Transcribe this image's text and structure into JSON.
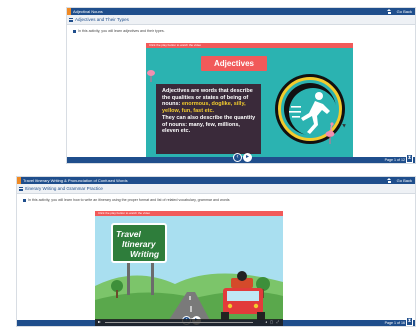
{
  "windows": [
    {
      "topbar": {
        "title": "Adjectival Nouns",
        "right_label": "Go Back"
      },
      "subbar": {
        "title": "Adjectives and Their Types"
      },
      "instruction": "In this activity, you will learn adjectives and their types.",
      "slide": {
        "header": "Click the play button to watch the video",
        "banner": "Adjectives",
        "paragraph1_pre": "Adjectives are words that describe the qualities or states of being of nouns: ",
        "paragraph1_examples": "enormous, doglike, silly, yellow, fun, fast etc.",
        "paragraph2": "They can also describe the quantity of nouns: many, few, millions, eleven etc."
      },
      "footer": {
        "page_indicator": "Page 1 of 12"
      }
    },
    {
      "topbar": {
        "title": "Travel Itinerary Writing & Pronunciation of Confused Words",
        "right_label": "Go Back"
      },
      "subbar": {
        "title": "Itinerary Writing and Grammar Practice"
      },
      "instruction": "In this activity, you will learn how to write an itinerary using the proper format and list of related vocabulary, grammar and words",
      "slide": {
        "header": "Click the play button to watch the video",
        "sign_line1": "Travel",
        "sign_line2": "Itinerary",
        "sign_line3": "Writing"
      },
      "footer": {
        "page_indicator": "Page 1 of 16"
      }
    }
  ],
  "colors": {
    "primary": "#1f4e8c",
    "accent_orange": "#f08a24",
    "slide_teal": "#2bb3b1",
    "slide_red": "#f15a5a",
    "highlight_yellow": "#f3cc2e"
  },
  "icons": [
    "home-icon",
    "menu-icon",
    "prev-icon",
    "play-icon",
    "timer-icon",
    "runner-icon",
    "flamingo-icon"
  ]
}
